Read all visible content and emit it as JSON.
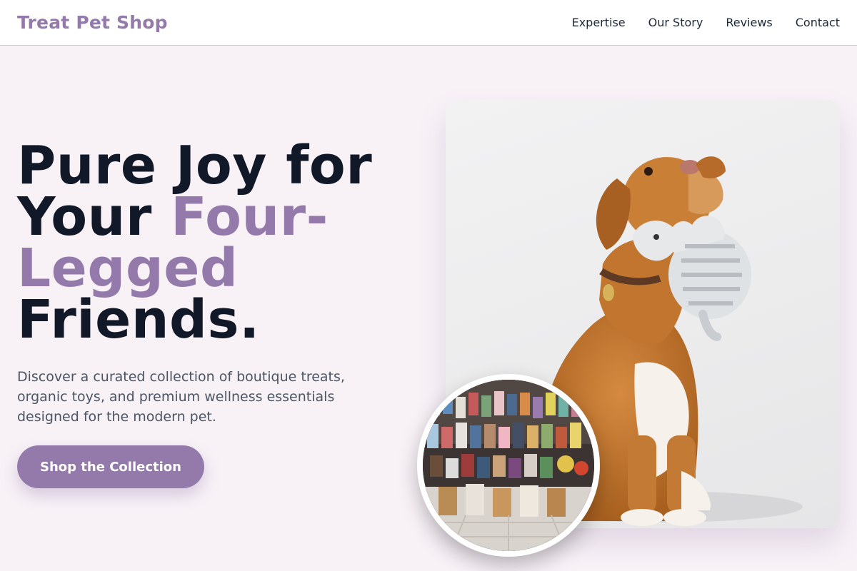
{
  "header": {
    "logo": "Treat Pet Shop",
    "nav": [
      "Expertise",
      "Our Story",
      "Reviews",
      "Contact"
    ]
  },
  "hero": {
    "headline_part1": "Pure Joy for",
    "headline_part2": "Your ",
    "headline_accent": "Four-Legged",
    "headline_part3": "Friends.",
    "subtext": "Discover a curated collection of boutique treats, organic toys, and premium wellness essentials designed for the modern pet.",
    "cta_label": "Shop the Collection"
  },
  "images": {
    "main": "dog-with-plush-toy-photo",
    "inset": "pet-store-shelves-photo"
  },
  "colors": {
    "accent": "#947aab",
    "text_dark": "#111827",
    "background": "#f8f2f7"
  }
}
